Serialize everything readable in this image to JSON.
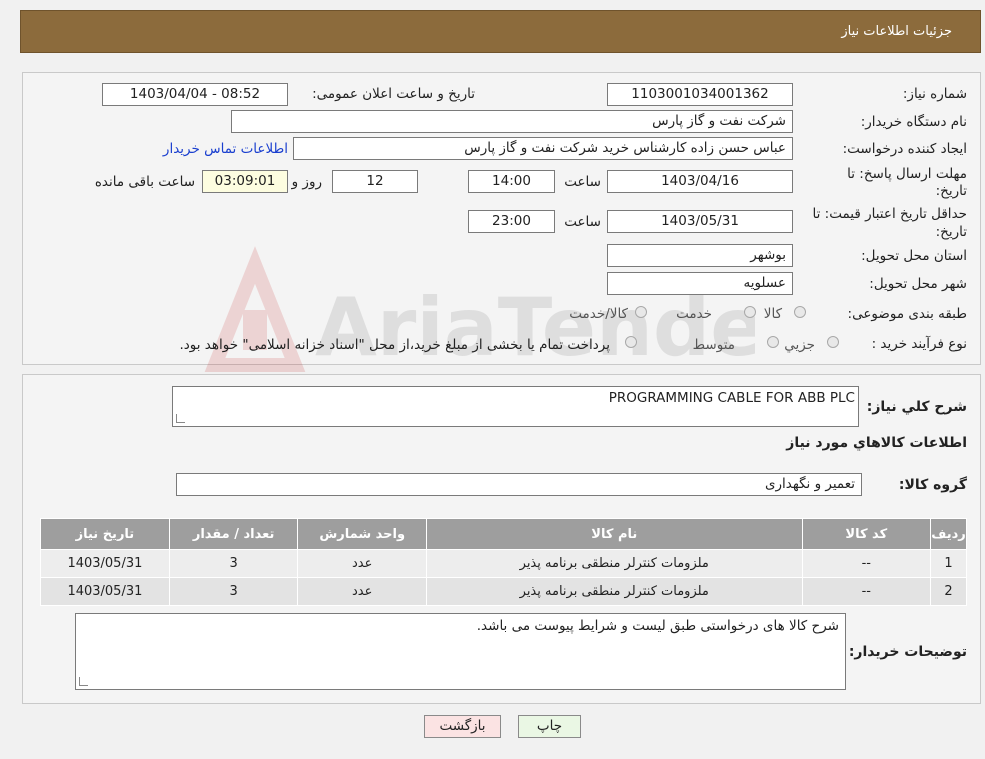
{
  "header": {
    "title": "جزئیات اطلاعات نیاز"
  },
  "form": {
    "need_number_label": "شماره نیاز:",
    "need_number": "1103001034001362",
    "announce_label": "تاریخ و ساعت اعلان عمومی:",
    "announce_value": "1403/04/04 - 08:52",
    "buyer_org_label": "نام دستگاه خریدار:",
    "buyer_org": "شرکت نفت و گاز پارس",
    "creator_label": "ایجاد کننده درخواست:",
    "creator": "عباس حسن زاده کارشناس خرید شرکت نفت و گاز پارس",
    "contact_link": "اطلاعات تماس خریدار",
    "deadline_label_1": "مهلت ارسال پاسخ: تا",
    "deadline_label_2": "تاریخ:",
    "deadline_date": "1403/04/16",
    "time_label": "ساعت",
    "deadline_time": "14:00",
    "days": "12",
    "days_label": "روز و",
    "remaining": "03:09:01",
    "remaining_label": "ساعت باقی مانده",
    "validity_label_1": "حداقل تاریخ اعتبار قیمت: تا",
    "validity_label_2": "تاریخ:",
    "validity_date": "1403/05/31",
    "validity_time": "23:00",
    "province_label": "استان محل تحویل:",
    "province": "بوشهر",
    "city_label": "شهر محل تحویل:",
    "city": "عسلویه",
    "category_label": "طبقه بندی موضوعی:",
    "category_options": [
      "کالا",
      "خدمت",
      "کالا/خدمت"
    ],
    "process_label": "نوع فرآیند خرید :",
    "process_options": [
      "جزیي",
      "متوسط"
    ],
    "process_note": "پرداخت تمام یا بخشی از مبلغ خرید،از محل \"اسناد خزانه اسلامی\" خواهد بود."
  },
  "details": {
    "summary_label": "شرح کلي نیاز:",
    "summary": "PROGRAMMING CABLE FOR ABB PLC",
    "goods_info_title": "اطلاعات کالاهاي مورد نیاز",
    "goods_group_label": "گروه کالا:",
    "goods_group": "تعمیر و نگهداری",
    "table_headers": [
      "ردیف",
      "کد کالا",
      "نام کالا",
      "واحد شمارش",
      "تعداد / مقدار",
      "تاریخ نیاز"
    ],
    "rows": [
      [
        "1",
        "--",
        "ملزومات کنترلر منطقی برنامه پذیر",
        "عدد",
        "3",
        "1403/05/31"
      ],
      [
        "2",
        "--",
        "ملزومات کنترلر منطقی برنامه پذیر",
        "عدد",
        "3",
        "1403/05/31"
      ]
    ],
    "buyer_notes_label": "توضیحات خریدار:",
    "buyer_notes": "شرح کالا های درخواستی طبق لیست و شرایط پیوست می باشد."
  },
  "buttons": {
    "print": "چاپ",
    "back": "بازگشت"
  },
  "watermark": {
    "text": "AriaTender.neT"
  }
}
